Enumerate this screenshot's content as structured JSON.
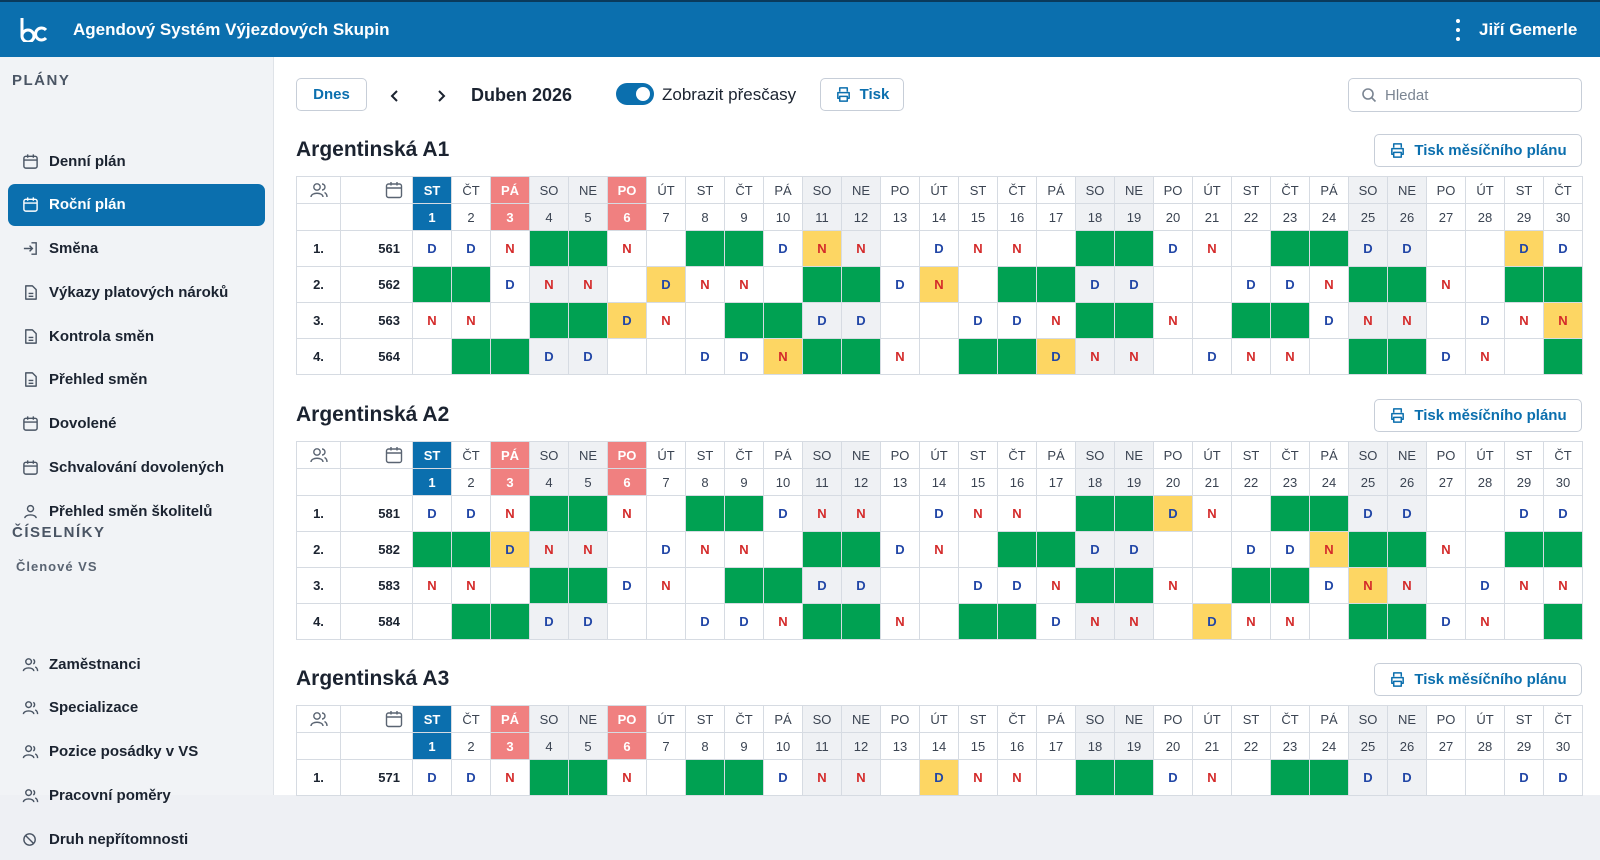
{
  "app": {
    "title": "Agendový Systém Výjezdových Skupin",
    "user": "Jiří Gemerle",
    "brand_color": "#0b6fae"
  },
  "sidebar": {
    "plans_title": "PLÁNY",
    "plans": [
      {
        "label": "Denní plán",
        "icon": "calendar-icon"
      },
      {
        "label": "Roční plán",
        "icon": "calendar-icon",
        "active": true
      },
      {
        "label": "Směna",
        "icon": "login-icon"
      },
      {
        "label": "Výkazy platových nároků",
        "icon": "document-icon"
      },
      {
        "label": "Kontrola směn",
        "icon": "document-icon"
      },
      {
        "label": "Přehled směn",
        "icon": "document-icon"
      },
      {
        "label": "Dovolené",
        "icon": "calendar-icon"
      },
      {
        "label": "Schvalování dovolených",
        "icon": "calendar-icon"
      },
      {
        "label": "Přehled směn školitelů",
        "icon": "user-icon"
      }
    ],
    "codebooks_title": "ČÍSELNÍKY",
    "members_subtitle": "Členové VS",
    "codebooks": [
      {
        "label": "Zaměstnanci",
        "icon": "users-icon"
      },
      {
        "label": "Specializace",
        "icon": "users-icon"
      },
      {
        "label": "Pozice posádky v VS",
        "icon": "users-icon"
      },
      {
        "label": "Pracovní poměry",
        "icon": "users-icon"
      },
      {
        "label": "Druh nepřítomnosti",
        "icon": "absence-icon"
      }
    ]
  },
  "toolbar": {
    "today_label": "Dnes",
    "month_label": "Duben 2026",
    "overtime_label": "Zobrazit přesčasy",
    "overtime_enabled": true,
    "print_label": "Tisk",
    "search_placeholder": "Hledat"
  },
  "print_month_label": "Tisk měsíčního plánu",
  "days": {
    "names": [
      "ST",
      "ČT",
      "PÁ",
      "SO",
      "NE",
      "PO",
      "ÚT",
      "ST",
      "ČT",
      "PÁ",
      "SO",
      "NE",
      "PO",
      "ÚT",
      "ST",
      "ČT",
      "PÁ",
      "SO",
      "NE",
      "PO",
      "ÚT",
      "ST",
      "ČT",
      "PÁ",
      "SO",
      "NE",
      "PO",
      "ÚT",
      "ST",
      "ČT"
    ],
    "numbers": [
      "1",
      "2",
      "3",
      "4",
      "5",
      "6",
      "7",
      "8",
      "9",
      "10",
      "11",
      "12",
      "13",
      "14",
      "15",
      "16",
      "17",
      "18",
      "19",
      "20",
      "21",
      "22",
      "23",
      "24",
      "25",
      "26",
      "27",
      "28",
      "29",
      "30"
    ],
    "weekend": [
      3,
      4,
      10,
      11,
      17,
      18,
      24,
      25
    ],
    "holidays": [
      2,
      5
    ],
    "today": 0
  },
  "legend_codes": {
    "D": "D",
    "N": "N",
    "green": "#00a152",
    "yellow": "#fdd663"
  },
  "groups": [
    {
      "title": "Argentinská A1",
      "rows": [
        {
          "idx": "1.",
          "num": "561",
          "cells": [
            "D",
            "D",
            "N",
            "G",
            "G",
            "N",
            "",
            "G",
            "G",
            "D",
            "yN",
            "N",
            "",
            "D",
            "N",
            "N",
            "",
            "G",
            "G",
            "D",
            "N",
            "",
            "G",
            "G",
            "D",
            "D",
            "",
            "",
            "yD",
            "D"
          ]
        },
        {
          "idx": "2.",
          "num": "562",
          "cells": [
            "G",
            "G",
            "D",
            "N",
            "N",
            "",
            "yD",
            "N",
            "N",
            "",
            "G",
            "G",
            "D",
            "yN",
            "",
            "G",
            "G",
            "D",
            "D",
            "",
            "",
            "D",
            "D",
            "N",
            "G",
            "G",
            "N",
            "",
            "G",
            "G"
          ]
        },
        {
          "idx": "3.",
          "num": "563",
          "cells": [
            "N",
            "N",
            "",
            "G",
            "G",
            "yD",
            "N",
            "",
            "G",
            "G",
            "D",
            "D",
            "",
            "",
            "D",
            "D",
            "N",
            "G",
            "G",
            "N",
            "",
            "G",
            "G",
            "D",
            "N",
            "N",
            "",
            "D",
            "N",
            "yN"
          ]
        },
        {
          "idx": "4.",
          "num": "564",
          "cells": [
            "",
            "G",
            "G",
            "D",
            "D",
            "",
            "",
            "D",
            "D",
            "yN",
            "G",
            "G",
            "N",
            "",
            "G",
            "G",
            "yD",
            "N",
            "N",
            "",
            "D",
            "N",
            "N",
            "",
            "G",
            "G",
            "D",
            "N",
            "",
            "G"
          ]
        }
      ]
    },
    {
      "title": "Argentinská A2",
      "rows": [
        {
          "idx": "1.",
          "num": "581",
          "cells": [
            "D",
            "D",
            "N",
            "G",
            "G",
            "N",
            "",
            "G",
            "G",
            "D",
            "N",
            "N",
            "",
            "D",
            "N",
            "N",
            "",
            "G",
            "G",
            "yD",
            "N",
            "",
            "G",
            "G",
            "D",
            "D",
            "",
            "",
            "D",
            "D"
          ]
        },
        {
          "idx": "2.",
          "num": "582",
          "cells": [
            "G",
            "G",
            "yD",
            "N",
            "N",
            "",
            "D",
            "N",
            "N",
            "",
            "G",
            "G",
            "D",
            "N",
            "",
            "G",
            "G",
            "D",
            "D",
            "",
            "",
            "D",
            "D",
            "yN",
            "G",
            "G",
            "N",
            "",
            "G",
            "G"
          ]
        },
        {
          "idx": "3.",
          "num": "583",
          "cells": [
            "N",
            "N",
            "",
            "G",
            "G",
            "D",
            "N",
            "",
            "G",
            "G",
            "D",
            "D",
            "",
            "",
            "D",
            "D",
            "N",
            "G",
            "G",
            "N",
            "",
            "G",
            "G",
            "D",
            "yN",
            "N",
            "",
            "D",
            "N",
            "N"
          ]
        },
        {
          "idx": "4.",
          "num": "584",
          "cells": [
            "",
            "G",
            "G",
            "D",
            "D",
            "",
            "",
            "D",
            "D",
            "N",
            "G",
            "G",
            "N",
            "",
            "G",
            "G",
            "D",
            "N",
            "N",
            "",
            "yD",
            "N",
            "N",
            "",
            "G",
            "G",
            "D",
            "N",
            "",
            "G"
          ]
        }
      ]
    },
    {
      "title": "Argentinská A3",
      "rows": [
        {
          "idx": "1.",
          "num": "571",
          "cells": [
            "D",
            "D",
            "N",
            "G",
            "G",
            "N",
            "",
            "G",
            "G",
            "D",
            "N",
            "N",
            "",
            "yD",
            "N",
            "N",
            "",
            "G",
            "G",
            "D",
            "N",
            "",
            "G",
            "G",
            "D",
            "D",
            "",
            "",
            "D",
            "D"
          ]
        }
      ]
    }
  ]
}
